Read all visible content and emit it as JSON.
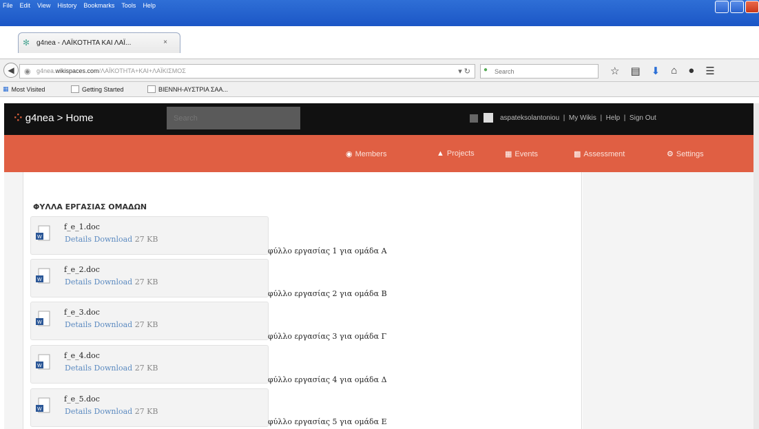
{
  "browser": {
    "menu": [
      "File",
      "Edit",
      "View",
      "History",
      "Bookmarks",
      "Tools",
      "Help"
    ],
    "tab_title": "g4nea - ΛΑΪΚΟΤΗΤΑ ΚΑΙ ΛΑΪ...",
    "tab_close": "×",
    "new_tab": "+",
    "url_domain_prefix": "g4nea.",
    "url_domain": "wikispaces.com",
    "url_path": "/ΛΑΪΚΟΤΗΤΑ+ΚΑΙ+ΛΑΪΚΙΣΜΟΣ",
    "search_placeholder": "Search",
    "bookmarks": [
      "Most Visited",
      "Getting Started",
      "ΒΙΕΝΝΗ-ΑΥΣΤΡΙΑ ΣΑΑ..."
    ]
  },
  "site": {
    "logo": "g4nea > Home",
    "search_placeholder": "Search",
    "user": "aspateksolantoniou",
    "links": [
      "My Wikis",
      "Help",
      "Sign Out"
    ],
    "nav": [
      "Members",
      "Projects",
      "Events",
      "Assessment",
      "Settings"
    ]
  },
  "content": {
    "heading": "ΦΥΛΛΑ ΕΡΓΑΣΙΑΣ ΟΜΑΔΩΝ",
    "files": [
      {
        "name": "f_e_1.doc",
        "details": "Details",
        "download": "Download",
        "size": "27 KB",
        "desc": "φύλλο εργασίας 1 για ομάδα Α"
      },
      {
        "name": "f_e_2.doc",
        "details": "Details",
        "download": "Download",
        "size": "27 KB",
        "desc": "φύλλο εργασίας 2 για ομάδα Β"
      },
      {
        "name": "f_e_3.doc",
        "details": "Details",
        "download": "Download",
        "size": "27 KB",
        "desc": "φύλλο εργασίας 3 για ομάδα Γ"
      },
      {
        "name": "f_e_4.doc",
        "details": "Details",
        "download": "Download",
        "size": "27 KB",
        "desc": "φύλλο εργασίας 4 για ομάδα Δ"
      },
      {
        "name": "f_e_5.doc",
        "details": "Details",
        "download": "Download",
        "size": "27 KB",
        "desc": "φύλλο εργασίας 5 για ομάδα Ε"
      }
    ]
  },
  "colors": {
    "header_black": "#111111",
    "nav_orange": "#e05f43",
    "link_blue": "#5b8ac0"
  }
}
